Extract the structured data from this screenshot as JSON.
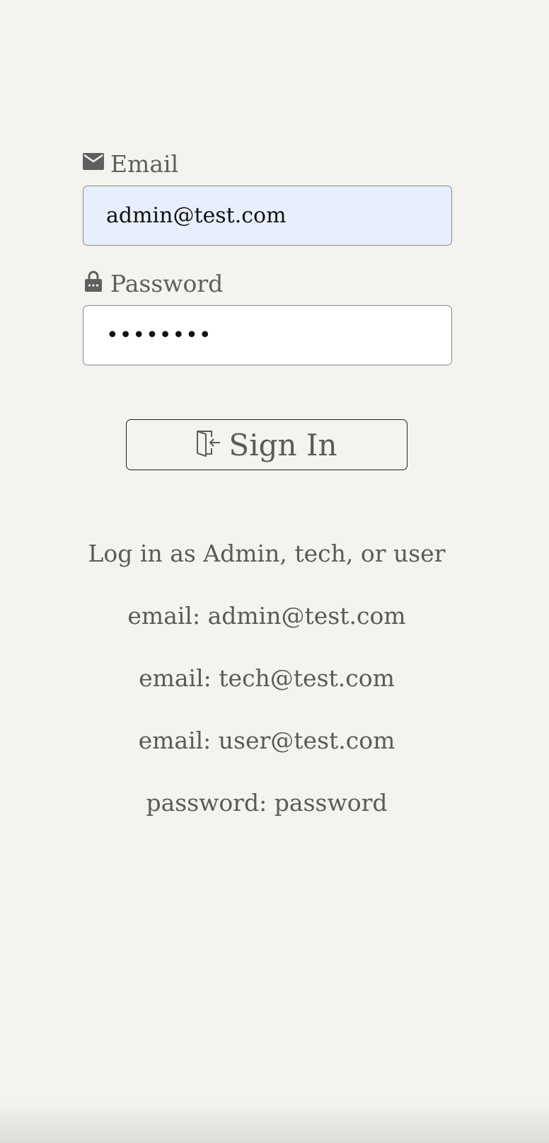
{
  "login_form": {
    "email_label": "Email",
    "email_icon": "envelope-icon",
    "email_value": "admin@test.com",
    "password_label": "Password",
    "password_icon": "lock-icon",
    "password_value": "password",
    "submit_label": "Sign In",
    "submit_icon": "sign-in-door-icon"
  },
  "hints": {
    "title": "Log in as Admin, tech, or user",
    "admin_email": "email: admin@test.com",
    "tech_email": "email: tech@test.com",
    "user_email": "email: user@test.com",
    "password": "password: password"
  },
  "colors": {
    "background": "#f4f3ef",
    "autofill_background": "#e8effc",
    "text": "#5d5d5d",
    "input_border": "#8a8a8a"
  }
}
